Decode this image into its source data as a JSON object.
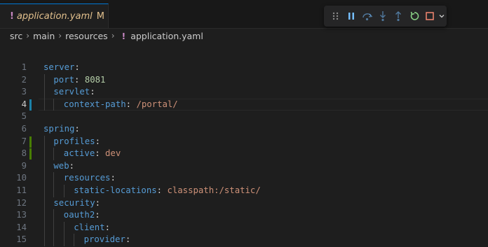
{
  "tab": {
    "icon": "yaml-exclamation-icon",
    "bang": "!",
    "filename": "application.yaml",
    "status": "M",
    "unsaved": true
  },
  "debug_toolbar": {
    "buttons": [
      "drag-handle",
      "pause",
      "step-over",
      "step-into",
      "step-out",
      "restart",
      "stop",
      "more"
    ]
  },
  "breadcrumb": {
    "items": [
      "src",
      "main",
      "resources"
    ],
    "file_bang": "!",
    "file": "application.yaml"
  },
  "editor": {
    "active_line": 4,
    "lines": [
      {
        "num": "1",
        "key": "server",
        "colon": ":",
        "value": "",
        "vtype": ""
      },
      {
        "num": "2",
        "key": "port",
        "colon": ":",
        "value": "8081",
        "vtype": "n"
      },
      {
        "num": "3",
        "key": "servlet",
        "colon": ":",
        "value": "",
        "vtype": ""
      },
      {
        "num": "4",
        "key": "context-path",
        "colon": ":",
        "value": "/portal/",
        "vtype": "s"
      },
      {
        "num": "5",
        "key": "",
        "colon": "",
        "value": "",
        "vtype": ""
      },
      {
        "num": "6",
        "key": "spring",
        "colon": ":",
        "value": "",
        "vtype": ""
      },
      {
        "num": "7",
        "key": "profiles",
        "colon": ":",
        "value": "",
        "vtype": ""
      },
      {
        "num": "8",
        "key": "active",
        "colon": ":",
        "value": "dev",
        "vtype": "s"
      },
      {
        "num": "9",
        "key": "web",
        "colon": ":",
        "value": "",
        "vtype": ""
      },
      {
        "num": "10",
        "key": "resources",
        "colon": ":",
        "value": "",
        "vtype": ""
      },
      {
        "num": "11",
        "key": "static-locations",
        "colon": ":",
        "value": "classpath:/static/",
        "vtype": "s"
      },
      {
        "num": "12",
        "key": "security",
        "colon": ":",
        "value": "",
        "vtype": ""
      },
      {
        "num": "13",
        "key": "oauth2",
        "colon": ":",
        "value": "",
        "vtype": ""
      },
      {
        "num": "14",
        "key": "client",
        "colon": ":",
        "value": "",
        "vtype": ""
      },
      {
        "num": "15",
        "key": "provider",
        "colon": ":",
        "value": "",
        "vtype": ""
      }
    ]
  },
  "colors": {
    "modified_marker": "#1b81a8",
    "added_marker": "#487e02",
    "key": "#569cd6",
    "string": "#ce9178",
    "number": "#b5cea8",
    "tab_modified_text": "#e2c08d"
  }
}
